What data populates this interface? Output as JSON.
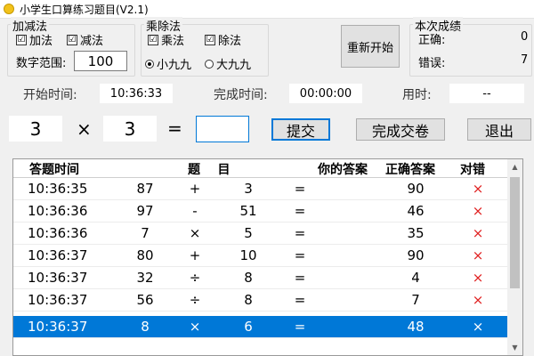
{
  "window": {
    "title": "小学生口算练习题目(V2.1)"
  },
  "add_sub": {
    "legend": "加减法",
    "add_label": "加法",
    "sub_label": "减法",
    "range_label": "数字范围:",
    "range_value": "100",
    "check": "☑"
  },
  "mul_div": {
    "legend": "乘除法",
    "mul_label": "乘法",
    "div_label": "除法",
    "small_table_label": "小九九",
    "big_table_label": "大九九",
    "check": "☑"
  },
  "restart_label": "重新开始",
  "score": {
    "legend": "本次成绩",
    "correct_label": "正确:",
    "correct_value": "0",
    "wrong_label": "错误:",
    "wrong_value": "7"
  },
  "timing": {
    "start_label": "开始时间:",
    "start_value": "10:36:33",
    "end_label": "完成时间:",
    "end_value": "00:00:00",
    "used_label": "用时:",
    "used_value": "--"
  },
  "question": {
    "a": "3",
    "op": "×",
    "b": "3",
    "eq": "=",
    "answer": ""
  },
  "buttons": {
    "submit": "提交",
    "finish": "完成交卷",
    "exit": "退出"
  },
  "table": {
    "headers": {
      "time": "答题时间",
      "question": "题    目",
      "your_answer": "你的答案",
      "correct_answer": "正确答案",
      "verdict": "对错"
    },
    "rows": [
      {
        "time": "10:36:35",
        "a": "87",
        "op": "+",
        "b": "3",
        "eq": "=",
        "your": "",
        "correct": "90",
        "mark": "×"
      },
      {
        "time": "10:36:36",
        "a": "97",
        "op": "-",
        "b": "51",
        "eq": "=",
        "your": "",
        "correct": "46",
        "mark": "×"
      },
      {
        "time": "10:36:36",
        "a": "7",
        "op": "×",
        "b": "5",
        "eq": "=",
        "your": "",
        "correct": "35",
        "mark": "×"
      },
      {
        "time": "10:36:37",
        "a": "80",
        "op": "+",
        "b": "10",
        "eq": "=",
        "your": "",
        "correct": "90",
        "mark": "×"
      },
      {
        "time": "10:36:37",
        "a": "32",
        "op": "÷",
        "b": "8",
        "eq": "=",
        "your": "",
        "correct": "4",
        "mark": "×"
      },
      {
        "time": "10:36:37",
        "a": "56",
        "op": "÷",
        "b": "8",
        "eq": "=",
        "your": "",
        "correct": "7",
        "mark": "×"
      },
      {
        "time": "10:36:37",
        "a": "8",
        "op": "×",
        "b": "6",
        "eq": "=",
        "your": "",
        "correct": "48",
        "mark": "×"
      }
    ],
    "selected_row": 6
  },
  "scroll": {
    "up": "▲",
    "down": "▼"
  }
}
